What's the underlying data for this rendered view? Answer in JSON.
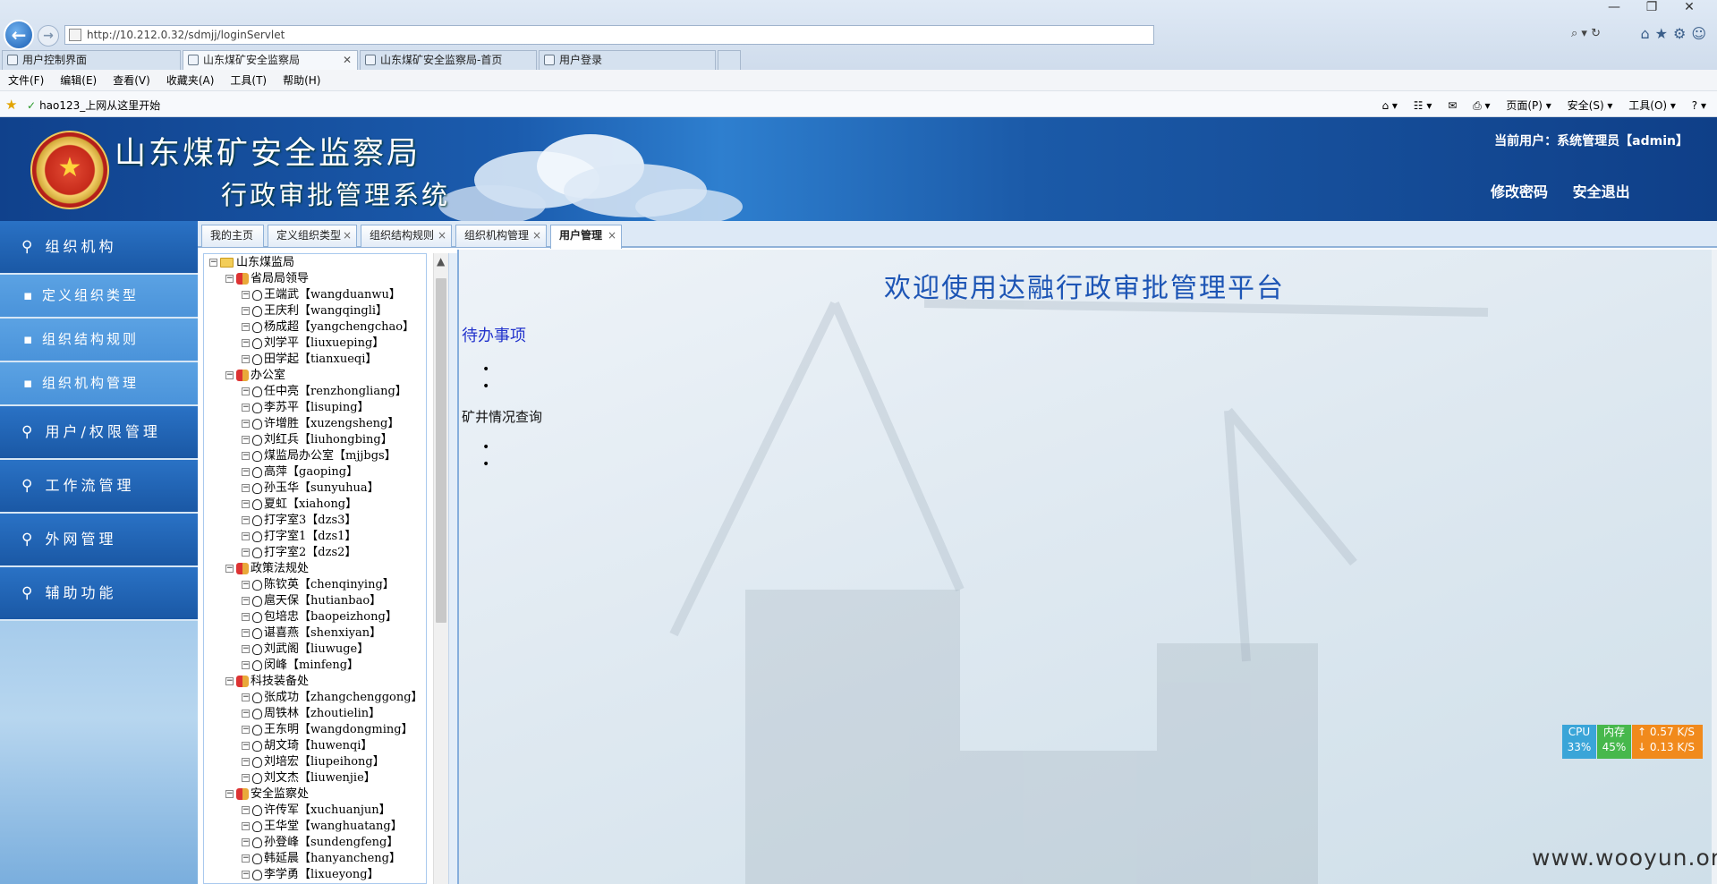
{
  "browser": {
    "url": "http://10.212.0.32/sdmjj/loginServlet",
    "tabs": [
      {
        "label": "用户控制界面",
        "active": false
      },
      {
        "label": "山东煤矿安全监察局",
        "active": true
      },
      {
        "label": "山东煤矿安全监察局-首页",
        "active": false
      },
      {
        "label": "用户登录",
        "active": false
      }
    ],
    "menu": [
      "文件(F)",
      "编辑(E)",
      "查看(V)",
      "收藏夹(A)",
      "工具(T)",
      "帮助(H)"
    ],
    "favorite": "hao123_上网从这里开始",
    "commands": [
      "页面(P) ▾",
      "安全(S) ▾",
      "工具(O) ▾"
    ]
  },
  "header": {
    "title_main": "山东煤矿安全监察局",
    "title_sub": "行政审批管理系统",
    "current_user": "当前用户：系统管理员【admin】",
    "change_password": "修改密码",
    "logout": "安全退出"
  },
  "sidebar": {
    "org": "组织机构",
    "sub1": "定义组织类型",
    "sub2": "组织结构规则",
    "sub3": "组织机构管理",
    "users": "用户/权限管理",
    "workflow": "工作流管理",
    "extranet": "外网管理",
    "aux": "辅助功能"
  },
  "content_tabs": {
    "t1": "我的主页",
    "t2": "定义组织类型",
    "t3": "组织结构规则",
    "t4": "组织机构管理",
    "t5": "用户管理"
  },
  "tree": {
    "root": "山东煤监局",
    "g1": "省局局领导",
    "g1_1": "王端武【wangduanwu】",
    "g1_2": "王庆利【wangqingli】",
    "g1_3": "杨成超【yangchengchao】",
    "g1_4": "刘学平【liuxueping】",
    "g1_5": "田学起【tianxueqi】",
    "g2": "办公室",
    "g2_1": "任中亮【renzhongliang】",
    "g2_2": "李苏平【lisuping】",
    "g2_3": "许增胜【xuzengsheng】",
    "g2_4": "刘红兵【liuhongbing】",
    "g2_5": "煤监局办公室【mjjbgs】",
    "g2_6": "高萍【gaoping】",
    "g2_7": "孙玉华【sunyuhua】",
    "g2_8": "夏虹【xiahong】",
    "g2_9": "打字室3【dzs3】",
    "g2_10": "打字室1【dzs1】",
    "g2_11": "打字室2【dzs2】",
    "g3": "政策法规处",
    "g3_1": "陈钦英【chenqinying】",
    "g3_2": "扈天保【hutianbao】",
    "g3_3": "包培忠【baopeizhong】",
    "g3_4": "谌喜燕【shenxiyan】",
    "g3_5": "刘武阁【liuwuge】",
    "g3_6": "闵峰【minfeng】",
    "g4": "科技装备处",
    "g4_1": "张成功【zhangchenggong】",
    "g4_2": "周铁林【zhoutielin】",
    "g4_3": "王东明【wangdongming】",
    "g4_4": "胡文琦【huwenqi】",
    "g4_5": "刘培宏【liupeihong】",
    "g4_6": "刘文杰【liuwenjie】",
    "g5": "安全监察处",
    "g5_1": "许传军【xuchuanjun】",
    "g5_2": "王华堂【wanghuatang】",
    "g5_3": "孙登峰【sundengfeng】",
    "g5_4": "韩延晨【hanyancheng】",
    "g5_5": "李学勇【lixueyong】"
  },
  "main": {
    "welcome": "欢迎使用达融行政审批管理平台",
    "todo": "待办事项",
    "mine_query": "矿井情况查询"
  },
  "perf": {
    "cpu_label": "CPU",
    "cpu_value": "33%",
    "mem_label": "内存",
    "mem_value": "45%",
    "up": "↑ 0.57 K/S",
    "down": "↓ 0.13 K/S"
  },
  "watermark": "www.wooyun.org"
}
